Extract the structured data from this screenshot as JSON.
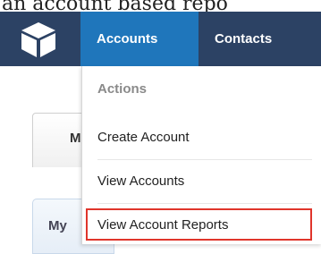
{
  "caption": "an account based repo",
  "navbar": {
    "tabs": [
      {
        "label": "Accounts"
      },
      {
        "label": "Contacts"
      }
    ]
  },
  "background": {
    "tab1_label": "M",
    "tab2_label": "My"
  },
  "dropdown": {
    "header": "Actions",
    "items": [
      {
        "label": "Create Account"
      },
      {
        "label": "View Accounts"
      },
      {
        "label": "View Account Reports"
      }
    ],
    "highlight_color": "#e0352b"
  },
  "colors": {
    "navbar_bg": "#2c4264",
    "active_tab_bg": "#1f76bb"
  }
}
